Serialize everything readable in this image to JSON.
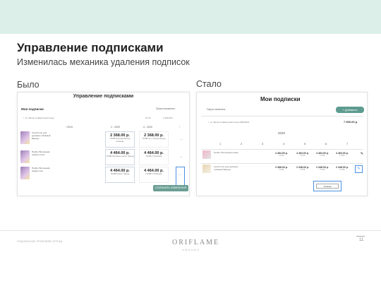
{
  "slide": {
    "title": "Управление подписками",
    "subtitle": "Изменилась механика удаления подписок",
    "before_label": "Было",
    "after_label": "Стало",
    "footer_text": "ПОДЛИННЫЙ ОРИФЛЕЙМ БРЕНД",
    "page_number": "11",
    "logo_text": "ORIFLAME",
    "logo_sub": "SWEDEN"
  },
  "before": {
    "title": "Управление подписками",
    "section": "Мои подписки",
    "pause_label": "Приостановлено",
    "address": "г. тут Янсон Совместный поход",
    "date": "27.03",
    "price": "1 690.00 р.",
    "nav": [
      "‹ 2019",
      "2 - 2020",
      "4 - 2020",
      "›"
    ],
    "products": [
      "Сухой гель для душевых «Нежный Бренд»",
      "Пробн. Всегонема номер в в мл.",
      "Пробн. Всегонема номер в мл."
    ],
    "cards": [
      {
        "price": "2 368.00 р.",
        "sub": "ПОЗВ Пробная Бренд «Новый»"
      },
      {
        "price": "2 368.00 р.",
        "sub": "ПОЗВ Сух. Проще Бренд"
      },
      {
        "price": "4 464.00 р.",
        "sub": "ПОЗВ Пробные Компл. Бренд"
      },
      {
        "price": "4 464.00 р.",
        "sub": "ПОЗВ 1 Пробный"
      },
      {
        "price": "4 464.00 р.",
        "sub": "ПОЗВ Компл. Бренд"
      },
      {
        "price": "4 464.00 р.",
        "sub": "ПОЗВ 1 Пробный"
      }
    ],
    "submit_label": "СОХРАНИТЬ ИЗМЕНЕНИЯ"
  },
  "after": {
    "title": "Мои подписки",
    "pause_label": "Пауза отменена",
    "add_label": "+ Добавить",
    "address": "г. тут Янсон Совместный поход 2020/2021",
    "total": "7 530.00 р.",
    "year": "2020",
    "months": [
      "1",
      "2",
      "3",
      "4",
      "5",
      "6",
      "7"
    ],
    "rows": [
      {
        "product": "Пробн. Всегонема номер",
        "values": [
          "4 464.00 р.",
          "4 464.00 р.",
          "4 464.00 р.",
          "4 464.00 р."
        ]
      },
      {
        "product": "Сухой гель для душевых «Нежный Бренд»",
        "values": [
          "2 368.00 р.",
          "2 348.00 р.",
          "2 348.00 р.",
          "2 348.00 р."
        ]
      }
    ],
    "cancel_label": "Отмена"
  }
}
